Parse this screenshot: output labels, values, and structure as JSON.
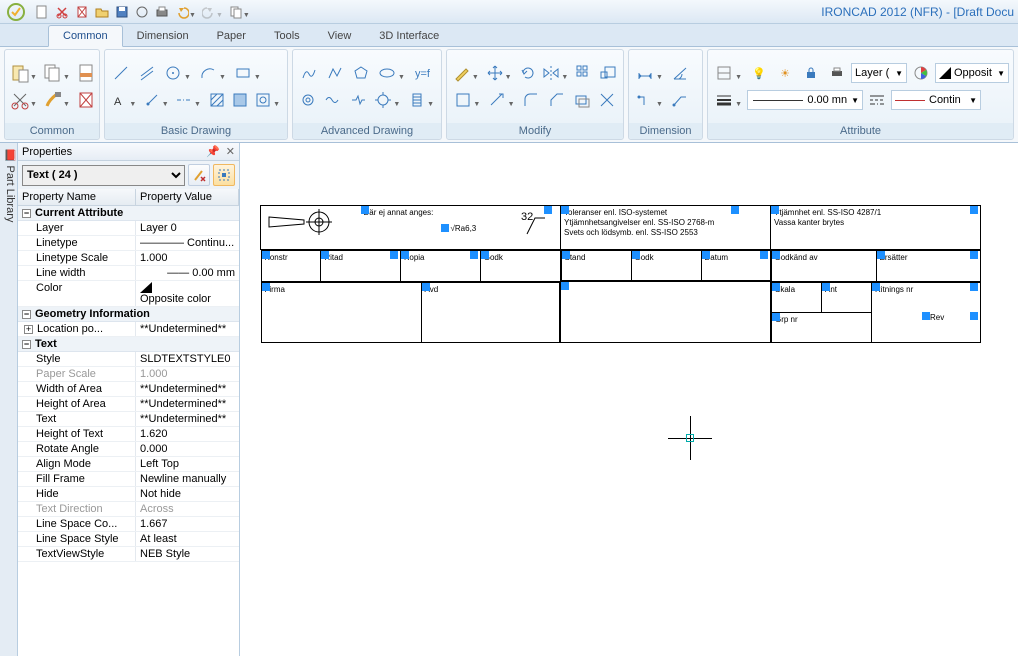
{
  "app": {
    "title": "IRONCAD 2012 (NFR) - [Draft Docu"
  },
  "tabs": {
    "items": [
      "Common",
      "Dimension",
      "Paper",
      "Tools",
      "View",
      "3D Interface"
    ],
    "active": 0
  },
  "ribbon": {
    "groups": [
      "Common",
      "Basic Drawing",
      "Advanced Drawing",
      "Modify",
      "Dimension",
      "Attribute"
    ],
    "attr_layer_label": "Layer (",
    "attr_opp_label": "Opposit",
    "attr_width_label": "0.00 mn",
    "attr_contin_label": "Contin"
  },
  "side_tab": "Part Library",
  "properties": {
    "title": "Properties",
    "selector": "Text ( 24 )",
    "head_name": "Property Name",
    "head_value": "Property Value",
    "sec_current": "Current Attribute",
    "sec_geom": "Geometry Information",
    "sec_text": "Text",
    "rows": {
      "layer": {
        "n": "Layer",
        "v": "Layer 0"
      },
      "linetype": {
        "n": "Linetype",
        "v": "———— Continu..."
      },
      "ltscale": {
        "n": "Linetype Scale",
        "v": "1.000"
      },
      "linewidth": {
        "n": "Line width",
        "v": "—— 0.00 mm"
      },
      "color": {
        "n": "Color",
        "v": "Opposite color"
      },
      "locpo": {
        "n": "Location po...",
        "v": "**Undetermined**"
      },
      "style": {
        "n": "Style",
        "v": "SLDTEXTSTYLE0"
      },
      "pscale": {
        "n": "Paper Scale",
        "v": "1.000"
      },
      "warea": {
        "n": "Width of Area",
        "v": "**Undetermined**"
      },
      "harea": {
        "n": "Height of Area",
        "v": "**Undetermined**"
      },
      "text": {
        "n": "Text",
        "v": "**Undetermined**"
      },
      "htext": {
        "n": "Height of Text",
        "v": "1.620"
      },
      "rot": {
        "n": "Rotate Angle",
        "v": "0.000"
      },
      "align": {
        "n": "Align Mode",
        "v": "Left Top"
      },
      "fill": {
        "n": "Fill Frame",
        "v": "Newline manually"
      },
      "hide": {
        "n": "Hide",
        "v": "Not hide"
      },
      "tdir": {
        "n": "Text Direction",
        "v": "Across"
      },
      "lsc": {
        "n": "Line Space Co...",
        "v": "1.667"
      },
      "lss": {
        "n": "Line Space Style",
        "v": "At least"
      },
      "tvs": {
        "n": "TextViewStyle",
        "v": "NEB Style"
      }
    }
  }
}
